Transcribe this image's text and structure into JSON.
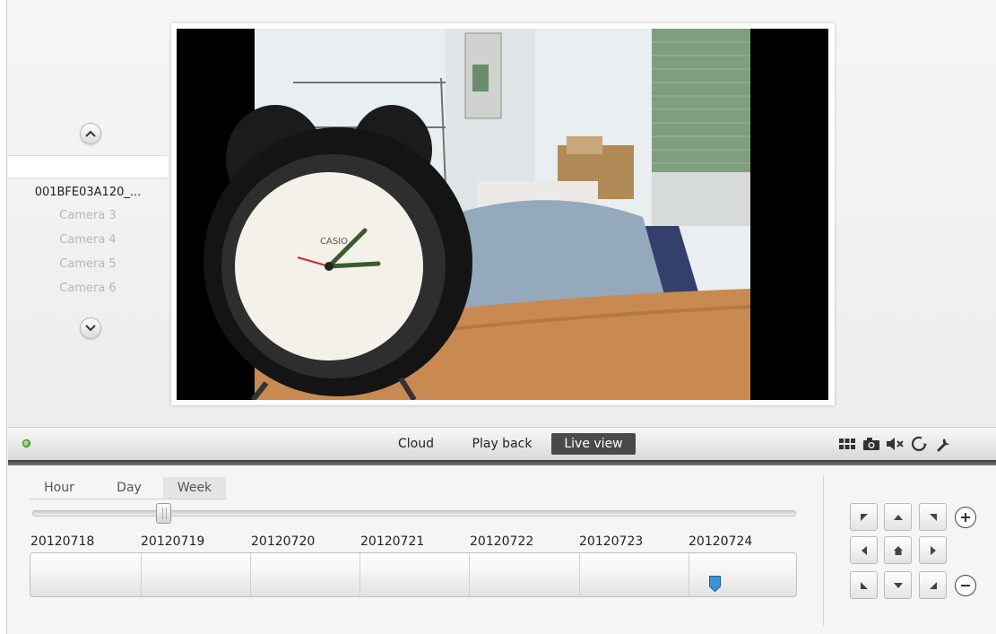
{
  "cameras": {
    "items": [
      {
        "label": "001BFE03A120_..."
      },
      {
        "label": "Camera 3"
      },
      {
        "label": "Camera 4"
      },
      {
        "label": "Camera 5"
      },
      {
        "label": "Camera 6"
      }
    ]
  },
  "toolbar": {
    "tabs": {
      "cloud": "Cloud",
      "playback": "Play back",
      "live": "Live view"
    },
    "icons": [
      "grid-layout-icon",
      "snapshot-camera-icon",
      "mute-icon",
      "refresh-icon",
      "settings-wrench-icon"
    ]
  },
  "timeline": {
    "range_tabs": {
      "hour": "Hour",
      "day": "Day",
      "week": "Week"
    },
    "selected_range": "Week",
    "dates": [
      "20120718",
      "20120719",
      "20120720",
      "20120721",
      "20120722",
      "20120723",
      "20120724"
    ]
  },
  "ptz": {
    "icons": [
      "pan-up-left-icon",
      "pan-up-icon",
      "pan-up-right-icon",
      "zoom-in-icon",
      "pan-left-icon",
      "home-icon",
      "pan-right-icon",
      "pan-down-left-icon",
      "pan-down-icon",
      "pan-down-right-icon",
      "zoom-out-icon"
    ]
  },
  "colors": {
    "live_tab_bg": "#4a4a4a",
    "status_ok": "#3aa51f",
    "marker": "#3f8fd6"
  }
}
